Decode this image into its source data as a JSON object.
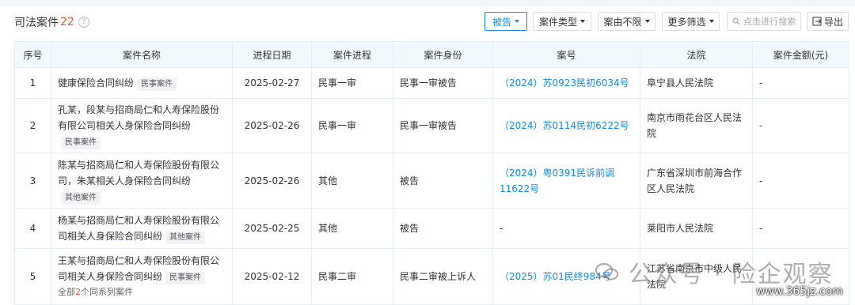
{
  "header": {
    "title": "司法案件",
    "count": "22",
    "help": "?"
  },
  "toolbar": {
    "role": "被告",
    "case_type": "案件类型",
    "year": "案由不限",
    "more": "更多筛选",
    "search_placeholder": "点击进行搜索",
    "export": "导出"
  },
  "table": {
    "headers": [
      "序号",
      "案件名称",
      "进程日期",
      "案件进程",
      "案件身份",
      "案号",
      "法院",
      "案件金额(元)"
    ],
    "rows": [
      {
        "no": "1",
        "name": "健康保险合同纠纷",
        "tag": "民事案件",
        "date": "2025-02-27",
        "stage": "民事一审",
        "role": "民事一审被告",
        "case_no": "（2024）苏0923民初6034号",
        "court": "阜宁县人民法院",
        "amount": "-"
      },
      {
        "no": "2",
        "name": "孔某，段某与招商局仁和人寿保险股份有限公司相关人身保险合同纠纷",
        "tag": "民事案件",
        "date": "2025-02-26",
        "stage": "民事一审",
        "role": "民事一审被告",
        "case_no": "（2024）苏0114民初6222号",
        "court": "南京市雨花台区人民法院",
        "amount": "-"
      },
      {
        "no": "3",
        "name": "陈某与招商局仁和人寿保险股份有限公司，朱某相关人身保险合同纠纷",
        "tag": "其他案件",
        "date": "2025-02-26",
        "stage": "其他",
        "role": "被告",
        "case_no": "（2024）粤0391民诉前调11622号",
        "court": "广东省深圳市前海合作区人民法院",
        "amount": "-"
      },
      {
        "no": "4",
        "name": "杨某与招商局仁和人寿保险股份有限公司相关人身保险合同纠纷",
        "tag": "其他案件",
        "date": "2025-02-25",
        "stage": "其他",
        "role": "被告",
        "case_no": "-",
        "court": "莱阳市人民法院",
        "amount": "-"
      },
      {
        "no": "5",
        "name": "王某与招商局仁和人寿保险股份有限公司相关人身保险合同纠纷",
        "tag": "民事案件",
        "date": "2025-02-12",
        "stage": "民事二审",
        "role": "民事二审被上诉人",
        "case_no": "（2025）苏01民终984号",
        "court": "江苏省南京市中级人民法院",
        "amount": "-",
        "series_prefix": "全部",
        "series_count": "2",
        "series_suffix": "个同系列案件"
      }
    ]
  },
  "watermark": {
    "text": "公众号 · 险企观察",
    "site": "www.365jz.com"
  }
}
